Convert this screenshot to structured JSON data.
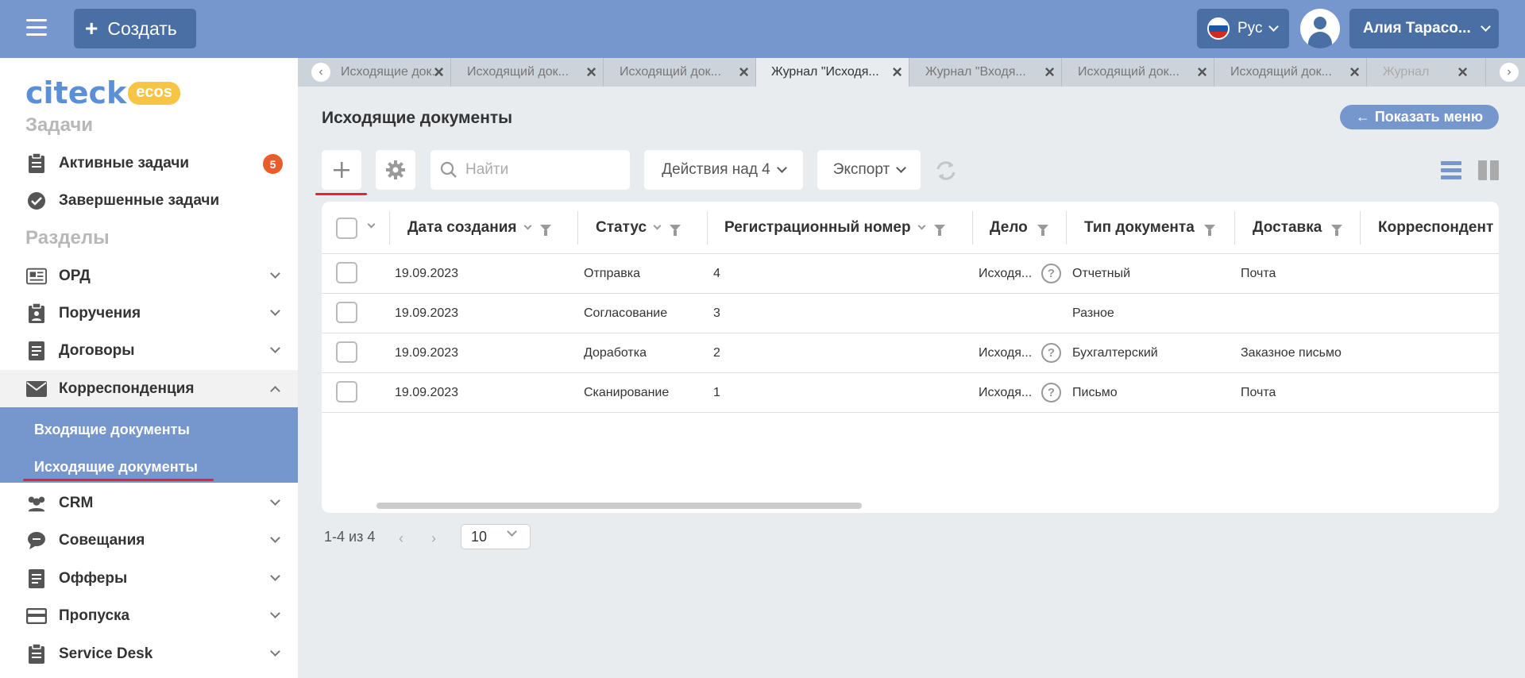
{
  "header": {
    "create_label": "Создать",
    "lang_label": "Рус",
    "user_name": "Алия Тарасо..."
  },
  "sidebar": {
    "logo_text": "citeck",
    "logo_badge": "ecos",
    "tasks_title": "Задачи",
    "sections_title": "Разделы",
    "tasks": [
      {
        "label": "Активные задачи",
        "badge": "5"
      },
      {
        "label": "Завершенные задачи"
      }
    ],
    "items": [
      {
        "label": "ОРД"
      },
      {
        "label": "Поручения"
      },
      {
        "label": "Договоры"
      },
      {
        "label": "Корреспонденция"
      },
      {
        "label": "CRM"
      },
      {
        "label": "Совещания"
      },
      {
        "label": "Офферы"
      },
      {
        "label": "Пропуска"
      },
      {
        "label": "Service Desk"
      }
    ],
    "submenu": [
      {
        "label": "Входящие документы"
      },
      {
        "label": "Исходящие документы"
      }
    ]
  },
  "tabs": [
    {
      "label": "Исходящие док..."
    },
    {
      "label": "Исходящий док..."
    },
    {
      "label": "Исходящий док..."
    },
    {
      "label": "Журнал \"Исходя..."
    },
    {
      "label": "Журнал \"Входя..."
    },
    {
      "label": "Исходящий док..."
    },
    {
      "label": "Исходящий док..."
    },
    {
      "label": "Журнал"
    }
  ],
  "main": {
    "title": "Исходящие документы",
    "show_menu": "Показать меню",
    "search_placeholder": "Найти",
    "actions_label": "Действия над 4",
    "export_label": "Экспорт"
  },
  "table": {
    "headers": [
      "Дата создания",
      "Статус",
      "Регистрационный номер",
      "Дело",
      "Тип документа",
      "Доставка",
      "Корреспондент"
    ],
    "rows": [
      {
        "date": "19.09.2023",
        "status": "Отправка",
        "reg": "4",
        "case": "Исходя...",
        "type": "Отчетный",
        "delivery": "Почта"
      },
      {
        "date": "19.09.2023",
        "status": "Согласование",
        "reg": "3",
        "case": "",
        "type": "Разное",
        "delivery": ""
      },
      {
        "date": "19.09.2023",
        "status": "Доработка",
        "reg": "2",
        "case": "Исходя...",
        "type": "Бухгалтерский",
        "delivery": "Заказное письмо"
      },
      {
        "date": "19.09.2023",
        "status": "Сканирование",
        "reg": "1",
        "case": "Исходя...",
        "type": "Письмо",
        "delivery": "Почта"
      }
    ]
  },
  "pager": {
    "range": "1-4 из 4",
    "page_size": "10"
  }
}
